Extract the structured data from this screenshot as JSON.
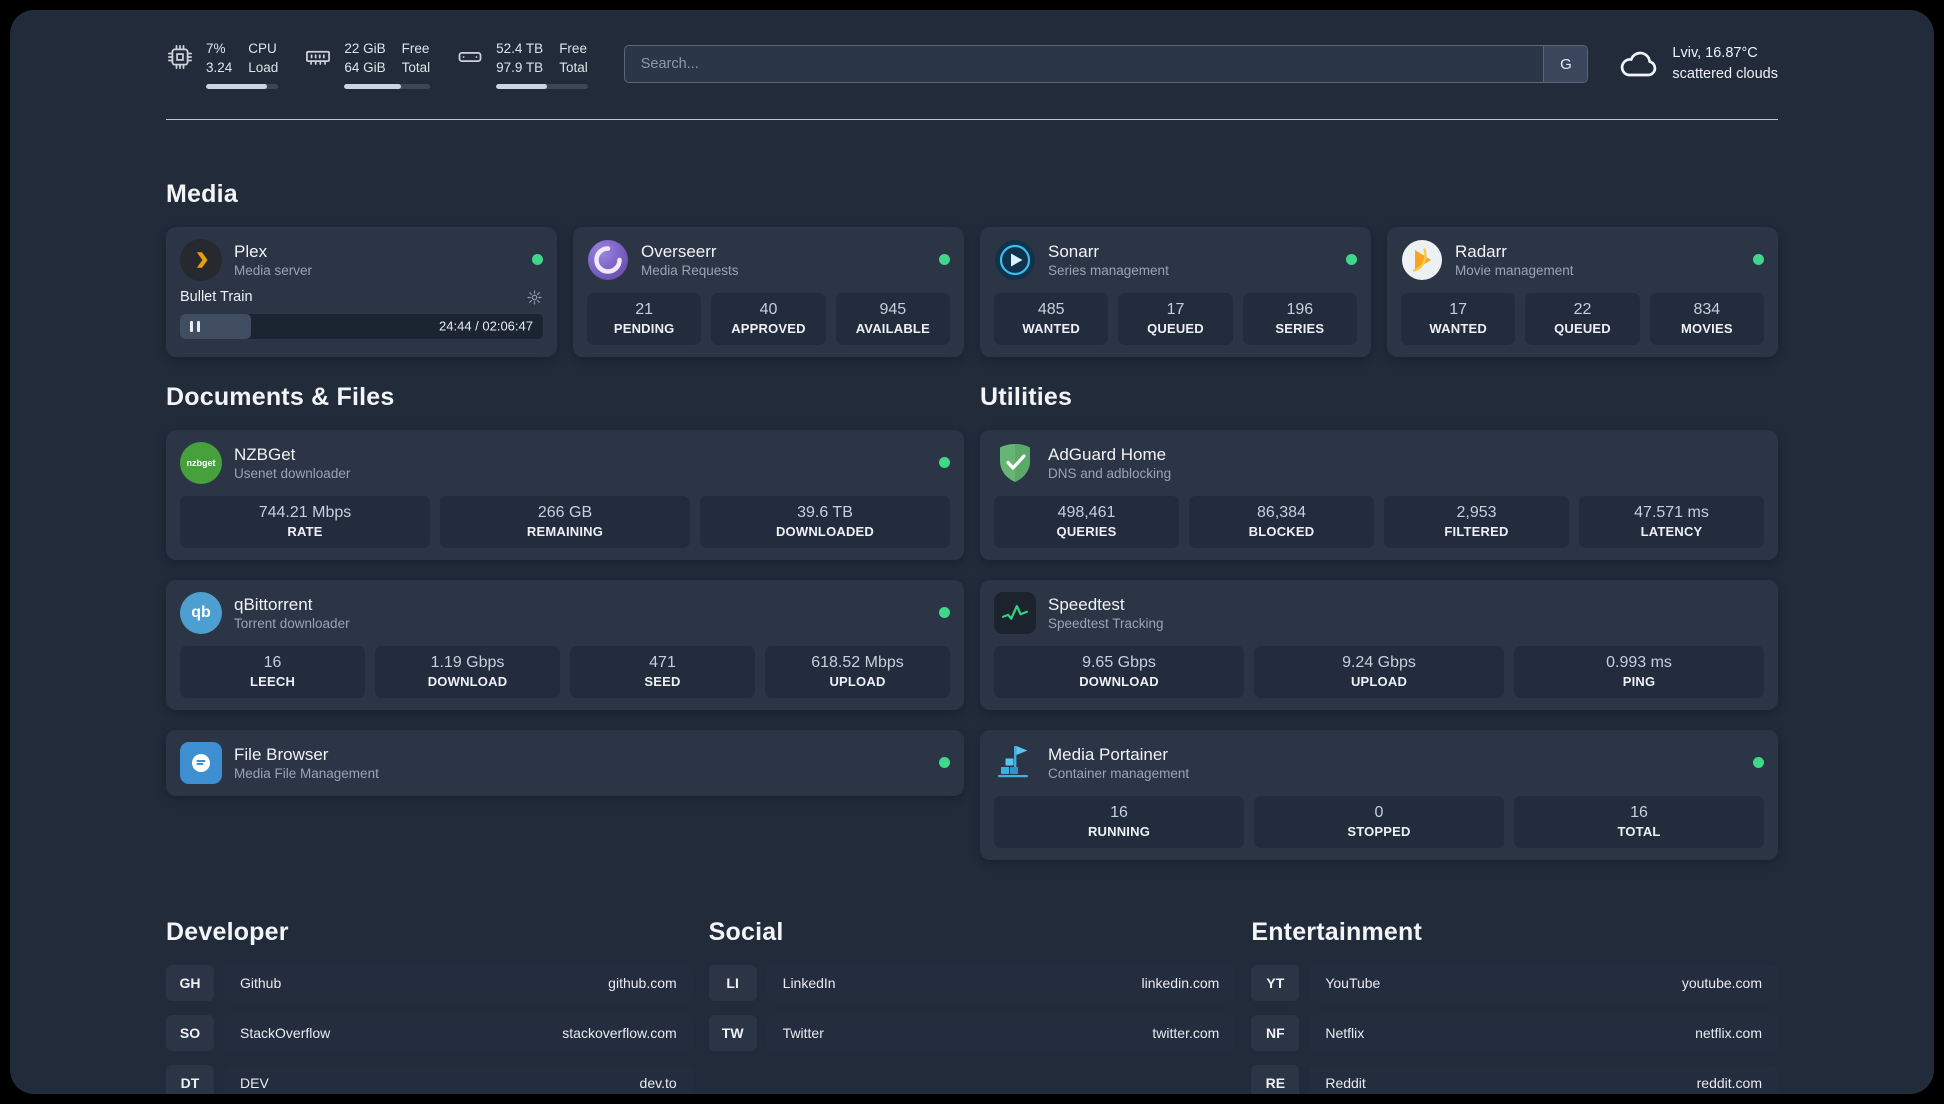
{
  "topbar": {
    "cpu": {
      "value_top": "7%",
      "value_bottom": "3.24",
      "label_top": "CPU",
      "label_bottom": "Load",
      "bar_style": "width:85%"
    },
    "memory": {
      "value_top": "22 GiB",
      "value_bottom": "64 GiB",
      "label_top": "Free",
      "label_bottom": "Total",
      "bar_style": "width:66%"
    },
    "disk": {
      "value_top": "52.4 TB",
      "value_bottom": "97.9 TB",
      "label_top": "Free",
      "label_bottom": "Total",
      "bar_style": "width:55%"
    },
    "search": {
      "placeholder": "Search...",
      "engine_button": "G"
    },
    "weather": {
      "location": "Lviv, 16.87°C",
      "condition": "scattered clouds"
    }
  },
  "media": {
    "heading": "Media",
    "plex": {
      "title": "Plex",
      "subtitle": "Media server",
      "now_playing": "Bullet Train",
      "time": "24:44 / 02:06:47",
      "progress_style": "width:19.5%"
    },
    "overseerr": {
      "title": "Overseerr",
      "subtitle": "Media Requests",
      "stats": [
        {
          "value": "21",
          "label": "PENDING"
        },
        {
          "value": "40",
          "label": "APPROVED"
        },
        {
          "value": "945",
          "label": "AVAILABLE"
        }
      ]
    },
    "sonarr": {
      "title": "Sonarr",
      "subtitle": "Series management",
      "stats": [
        {
          "value": "485",
          "label": "WANTED"
        },
        {
          "value": "17",
          "label": "QUEUED"
        },
        {
          "value": "196",
          "label": "SERIES"
        }
      ]
    },
    "radarr": {
      "title": "Radarr",
      "subtitle": "Movie management",
      "stats": [
        {
          "value": "17",
          "label": "WANTED"
        },
        {
          "value": "22",
          "label": "QUEUED"
        },
        {
          "value": "834",
          "label": "MOVIES"
        }
      ]
    }
  },
  "documents": {
    "heading": "Documents & Files",
    "nzbget": {
      "title": "NZBGet",
      "subtitle": "Usenet downloader",
      "stats": [
        {
          "value": "744.21 Mbps",
          "label": "RATE"
        },
        {
          "value": "266 GB",
          "label": "REMAINING"
        },
        {
          "value": "39.6 TB",
          "label": "DOWNLOADED"
        }
      ]
    },
    "qbittorrent": {
      "title": "qBittorrent",
      "subtitle": "Torrent downloader",
      "stats": [
        {
          "value": "16",
          "label": "LEECH"
        },
        {
          "value": "1.19 Gbps",
          "label": "DOWNLOAD"
        },
        {
          "value": "471",
          "label": "SEED"
        },
        {
          "value": "618.52 Mbps",
          "label": "UPLOAD"
        }
      ]
    },
    "filebrowser": {
      "title": "File Browser",
      "subtitle": "Media File Management"
    }
  },
  "utilities": {
    "heading": "Utilities",
    "adguard": {
      "title": "AdGuard Home",
      "subtitle": "DNS and adblocking",
      "stats": [
        {
          "value": "498,461",
          "label": "QUERIES"
        },
        {
          "value": "86,384",
          "label": "BLOCKED"
        },
        {
          "value": "2,953",
          "label": "FILTERED"
        },
        {
          "value": "47.571 ms",
          "label": "LATENCY"
        }
      ]
    },
    "speedtest": {
      "title": "Speedtest",
      "subtitle": "Speedtest Tracking",
      "stats": [
        {
          "value": "9.65 Gbps",
          "label": "DOWNLOAD"
        },
        {
          "value": "9.24 Gbps",
          "label": "UPLOAD"
        },
        {
          "value": "0.993 ms",
          "label": "PING"
        }
      ]
    },
    "portainer": {
      "title": "Media Portainer",
      "subtitle": "Container management",
      "stats": [
        {
          "value": "16",
          "label": "RUNNING"
        },
        {
          "value": "0",
          "label": "STOPPED"
        },
        {
          "value": "16",
          "label": "TOTAL"
        }
      ]
    }
  },
  "developer": {
    "heading": "Developer",
    "items": [
      {
        "abbr": "GH",
        "name": "Github",
        "url": "github.com"
      },
      {
        "abbr": "SO",
        "name": "StackOverflow",
        "url": "stackoverflow.com"
      },
      {
        "abbr": "DT",
        "name": "DEV",
        "url": "dev.to"
      }
    ]
  },
  "social": {
    "heading": "Social",
    "items": [
      {
        "abbr": "LI",
        "name": "LinkedIn",
        "url": "linkedin.com"
      },
      {
        "abbr": "TW",
        "name": "Twitter",
        "url": "twitter.com"
      }
    ]
  },
  "entertainment": {
    "heading": "Entertainment",
    "items": [
      {
        "abbr": "YT",
        "name": "YouTube",
        "url": "youtube.com"
      },
      {
        "abbr": "NF",
        "name": "Netflix",
        "url": "netflix.com"
      },
      {
        "abbr": "RE",
        "name": "Reddit",
        "url": "reddit.com"
      }
    ]
  },
  "icons": {
    "cpu-icon": "processor chip outline",
    "memory-icon": "ram module outline",
    "disk-icon": "hard drive outline",
    "cloud-icon": "white cloud outline",
    "search-engine-button": "letter G",
    "plex-icon": "amber chevron on dark circle",
    "overseerr-icon": "white spiral on purple circle",
    "sonarr-icon": "play arrow with ring on dark blue circle",
    "radarr-icon": "amber play arrow with swoosh on light circle",
    "nzbget-icon": "green circle with nzbget wordmark",
    "qbittorrent-icon": "blue circle with qb letters",
    "filebrowser-icon": "blue rounded square with white disc",
    "adguard-icon": "green shield with white check",
    "speedtest-icon": "green graph line on dark square",
    "portainer-icon": "light blue crane with containers",
    "gear-icon": "settings gear",
    "pause-icon": "two pause bars",
    "status-dot": "green online indicator"
  },
  "colors": {
    "frame": "#000000",
    "page_bg": "#212b3a",
    "card_bg": "#2b3545",
    "tile_bg": "#222c3c",
    "status_online": "#3fd78a",
    "divider": "#dbe2ea",
    "plex_amber": "#e5a00d"
  }
}
